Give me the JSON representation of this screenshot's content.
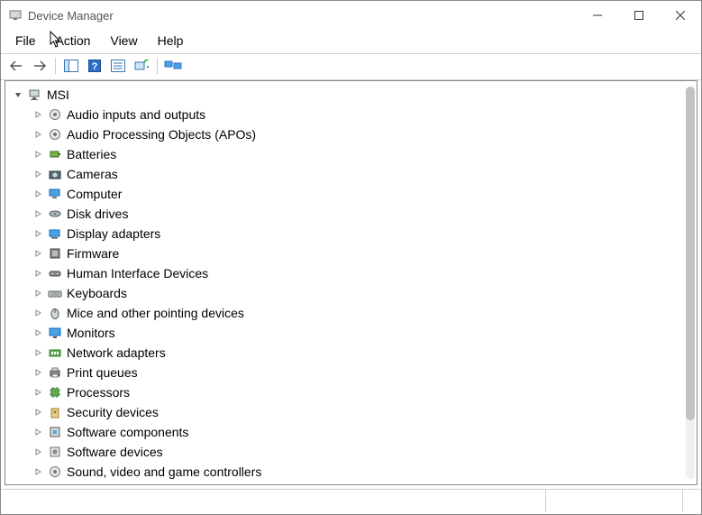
{
  "titlebar": {
    "title": "Device Manager"
  },
  "menubar": {
    "file": "File",
    "action": "Action",
    "view": "View",
    "help": "Help"
  },
  "toolbar": {
    "back": "back",
    "forward": "forward",
    "show_hide": "show-hide-console-tree",
    "help": "help",
    "properties": "properties",
    "scan": "scan-for-changes",
    "monitors": "monitors"
  },
  "tree": {
    "root": {
      "label": "MSI",
      "icon": "computer-root-icon",
      "expanded": true
    },
    "children": [
      {
        "label": "Audio inputs and outputs",
        "icon": "speaker-icon"
      },
      {
        "label": "Audio Processing Objects (APOs)",
        "icon": "speaker-icon"
      },
      {
        "label": "Batteries",
        "icon": "battery-icon"
      },
      {
        "label": "Cameras",
        "icon": "camera-icon"
      },
      {
        "label": "Computer",
        "icon": "computer-icon"
      },
      {
        "label": "Disk drives",
        "icon": "disk-icon"
      },
      {
        "label": "Display adapters",
        "icon": "display-adapter-icon"
      },
      {
        "label": "Firmware",
        "icon": "firmware-icon"
      },
      {
        "label": "Human Interface Devices",
        "icon": "hid-icon"
      },
      {
        "label": "Keyboards",
        "icon": "keyboard-icon"
      },
      {
        "label": "Mice and other pointing devices",
        "icon": "mouse-icon"
      },
      {
        "label": "Monitors",
        "icon": "monitor-icon"
      },
      {
        "label": "Network adapters",
        "icon": "network-icon"
      },
      {
        "label": "Print queues",
        "icon": "printer-icon"
      },
      {
        "label": "Processors",
        "icon": "processor-icon"
      },
      {
        "label": "Security devices",
        "icon": "security-icon"
      },
      {
        "label": "Software components",
        "icon": "software-component-icon"
      },
      {
        "label": "Software devices",
        "icon": "software-device-icon"
      },
      {
        "label": "Sound, video and game controllers",
        "icon": "sound-video-icon"
      }
    ]
  }
}
